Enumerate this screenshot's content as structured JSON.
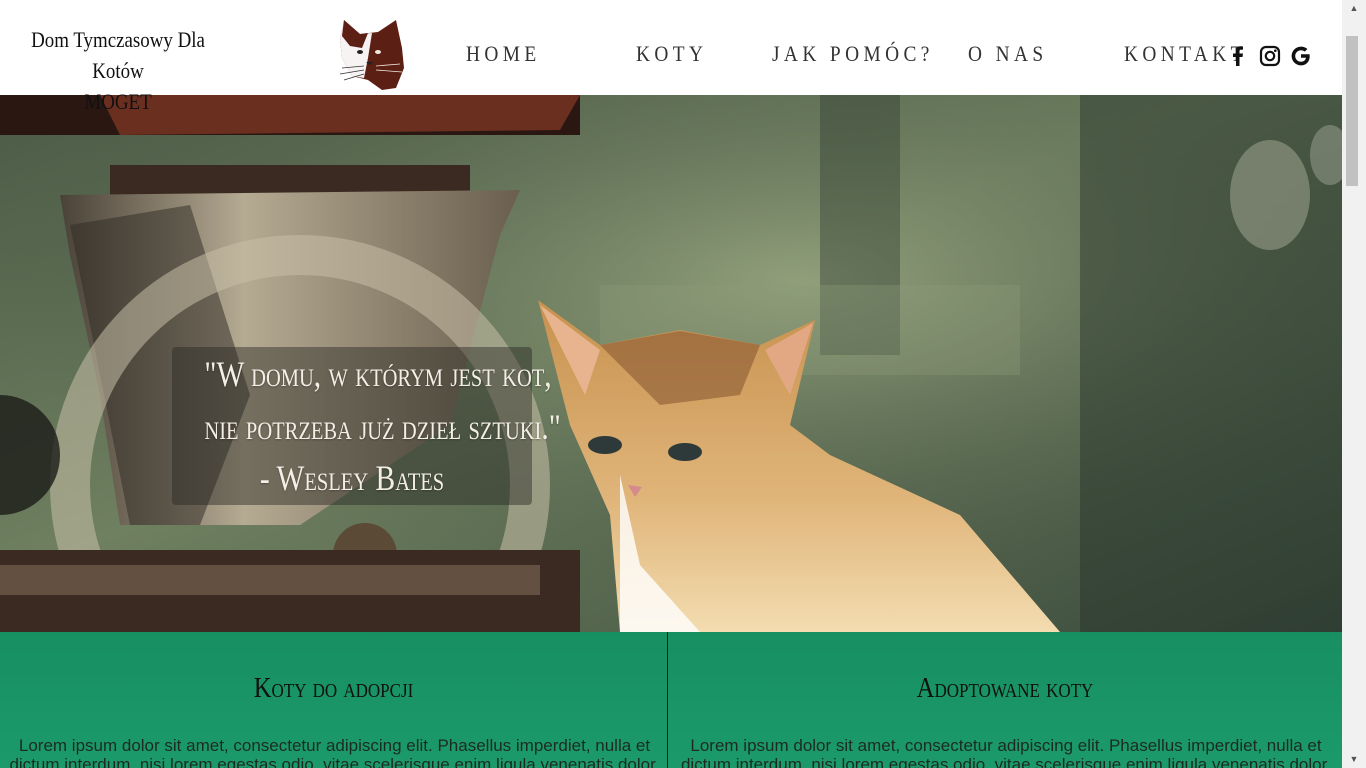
{
  "header": {
    "title_line1": "Dom Tymczasowy Dla Kotów",
    "title_line2": "MOGET"
  },
  "nav": [
    {
      "label": "HOME"
    },
    {
      "label": "KOTY"
    },
    {
      "label": "JAK POMÓC?"
    },
    {
      "label": "O NAS"
    },
    {
      "label": "KONTAKT"
    }
  ],
  "social": [
    "facebook-icon",
    "instagram-icon",
    "google-icon"
  ],
  "hero": {
    "quote_line1": "\"W domu, w którym jest kot,",
    "quote_line2": "nie potrzeba już dzieł sztuki.\"",
    "quote_author": "- Wesley Bates"
  },
  "panels": [
    {
      "title": "Koty do adopcji",
      "text": "Lorem ipsum dolor sit amet, consectetur adipiscing elit. Phasellus imperdiet, nulla et dictum interdum, nisi lorem egestas odio, vitae scelerisque enim ligula venenatis dolor. Maecenas nisl est"
    },
    {
      "title": "Adoptowane koty",
      "text": "Lorem ipsum dolor sit amet, consectetur adipiscing elit. Phasellus imperdiet, nulla et dictum interdum, nisi lorem egestas odio, vitae scelerisque enim ligula venenatis dolor. Maecenas nisl est"
    }
  ],
  "colors": {
    "panel_green": "#178f62",
    "logo_brown": "#5c1f14"
  }
}
